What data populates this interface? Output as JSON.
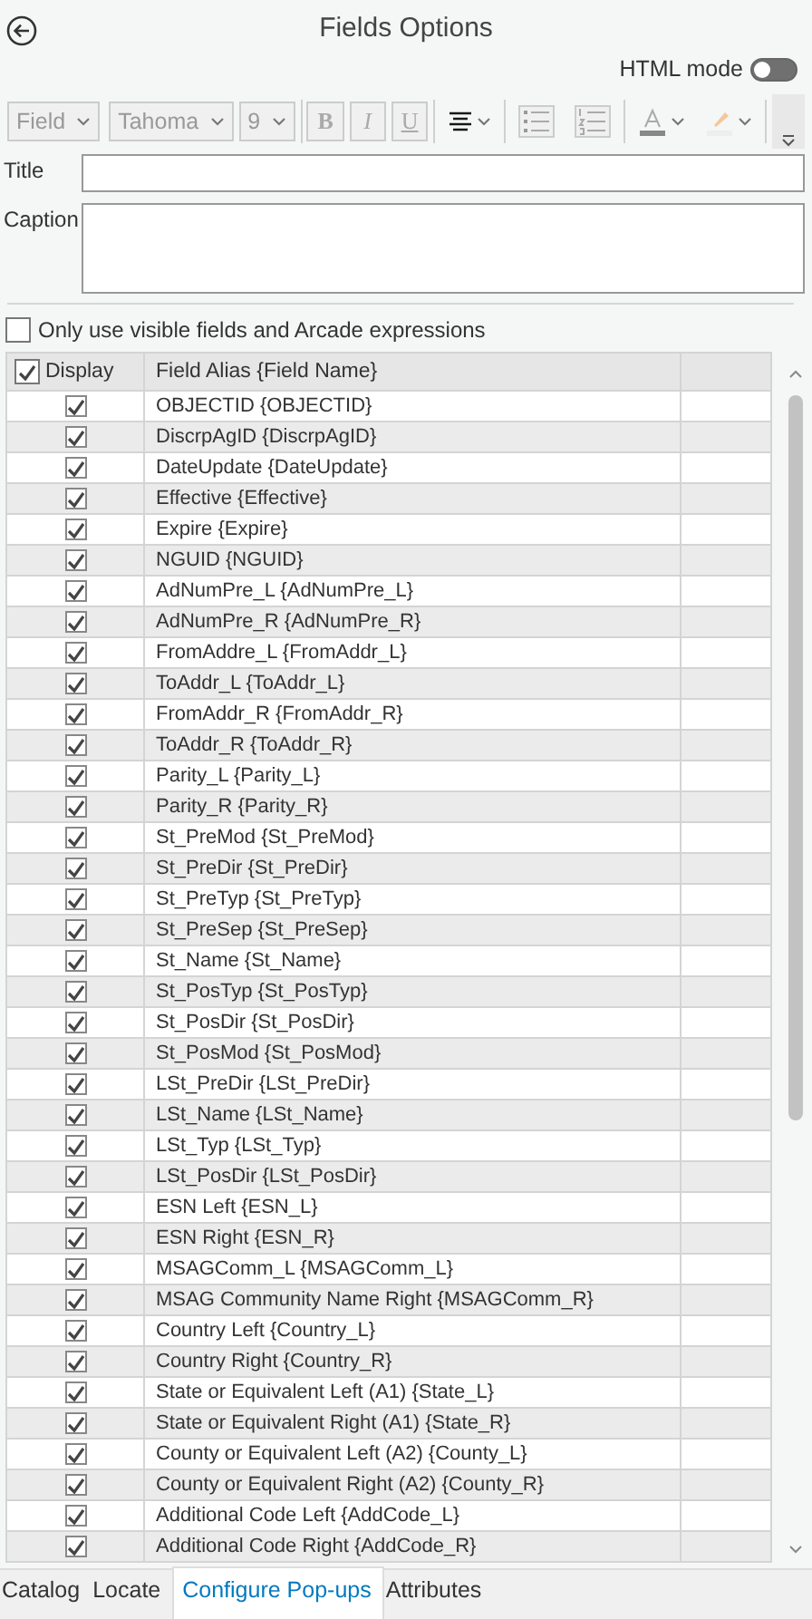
{
  "header": {
    "title": "Fields Options"
  },
  "html_mode": {
    "label": "HTML mode",
    "on": false
  },
  "toolbar": [
    {
      "kind": "select",
      "label": "Field",
      "disabled": true
    },
    {
      "kind": "select",
      "label": "Tahoma",
      "disabled": true
    },
    {
      "kind": "select",
      "label": "9",
      "disabled": true
    },
    {
      "kind": "toggle",
      "label": "B",
      "disabled": true
    },
    {
      "kind": "toggle",
      "label": "I",
      "disabled": true
    },
    {
      "kind": "toggle",
      "label": "U",
      "disabled": true
    },
    {
      "kind": "align",
      "disabled": false
    },
    {
      "kind": "bullets",
      "disabled": true
    },
    {
      "kind": "numbering",
      "disabled": true
    },
    {
      "kind": "fontcolor",
      "disabled": true
    },
    {
      "kind": "highlight",
      "disabled": true
    }
  ],
  "title_field": {
    "label": "Title"
  },
  "caption_field": {
    "label": "Caption"
  },
  "visible_only": {
    "label": "Only use visible fields and Arcade expressions",
    "checked": false
  },
  "table": {
    "columns": [
      {
        "label": "Display",
        "checked": true
      },
      {
        "label": "Field Alias {Field Name}"
      }
    ],
    "rows": [
      {
        "alias": "OBJECTID {OBJECTID}",
        "checked": true
      },
      {
        "alias": "DiscrpAgID {DiscrpAgID}",
        "checked": true
      },
      {
        "alias": "DateUpdate {DateUpdate}",
        "checked": true
      },
      {
        "alias": "Effective {Effective}",
        "checked": true
      },
      {
        "alias": "Expire {Expire}",
        "checked": true
      },
      {
        "alias": "NGUID {NGUID}",
        "checked": true
      },
      {
        "alias": "AdNumPre_L {AdNumPre_L}",
        "checked": true
      },
      {
        "alias": "AdNumPre_R {AdNumPre_R}",
        "checked": true
      },
      {
        "alias": "FromAddre_L {FromAddr_L}",
        "checked": true
      },
      {
        "alias": "ToAddr_L {ToAddr_L}",
        "checked": true
      },
      {
        "alias": "FromAddr_R {FromAddr_R}",
        "checked": true
      },
      {
        "alias": "ToAddr_R {ToAddr_R}",
        "checked": true
      },
      {
        "alias": "Parity_L {Parity_L}",
        "checked": true
      },
      {
        "alias": "Parity_R {Parity_R}",
        "checked": true
      },
      {
        "alias": "St_PreMod {St_PreMod}",
        "checked": true
      },
      {
        "alias": "St_PreDir {St_PreDir}",
        "checked": true
      },
      {
        "alias": "St_PreTyp {St_PreTyp}",
        "checked": true
      },
      {
        "alias": "St_PreSep {St_PreSep}",
        "checked": true
      },
      {
        "alias": "St_Name {St_Name}",
        "checked": true
      },
      {
        "alias": "St_PosTyp {St_PosTyp}",
        "checked": true
      },
      {
        "alias": "St_PosDir {St_PosDir}",
        "checked": true
      },
      {
        "alias": "St_PosMod {St_PosMod}",
        "checked": true
      },
      {
        "alias": "LSt_PreDir {LSt_PreDir}",
        "checked": true
      },
      {
        "alias": "LSt_Name {LSt_Name}",
        "checked": true
      },
      {
        "alias": "LSt_Typ {LSt_Typ}",
        "checked": true
      },
      {
        "alias": "LSt_PosDir {LSt_PosDir}",
        "checked": true
      },
      {
        "alias": "ESN Left {ESN_L}",
        "checked": true
      },
      {
        "alias": "ESN Right {ESN_R}",
        "checked": true
      },
      {
        "alias": "MSAGComm_L {MSAGComm_L}",
        "checked": true
      },
      {
        "alias": "MSAG Community Name Right {MSAGComm_R}",
        "checked": true
      },
      {
        "alias": "Country Left {Country_L}",
        "checked": true
      },
      {
        "alias": "Country Right {Country_R}",
        "checked": true
      },
      {
        "alias": "State or Equivalent Left (A1) {State_L}",
        "checked": true
      },
      {
        "alias": "State or Equivalent Right (A1) {State_R}",
        "checked": true
      },
      {
        "alias": "County or Equivalent Left (A2) {County_L}",
        "checked": true
      },
      {
        "alias": "County or Equivalent Right (A2) {County_R}",
        "checked": true
      },
      {
        "alias": "Additional Code Left {AddCode_L}",
        "checked": true
      },
      {
        "alias": "Additional Code Right {AddCode_R}",
        "checked": true
      }
    ]
  },
  "bottom_tabs": [
    {
      "label": "Catalog",
      "selected": false
    },
    {
      "label": "Locate",
      "selected": false
    },
    {
      "label": "Configure Pop-ups",
      "selected": true
    },
    {
      "label": "Attributes",
      "selected": false
    }
  ]
}
